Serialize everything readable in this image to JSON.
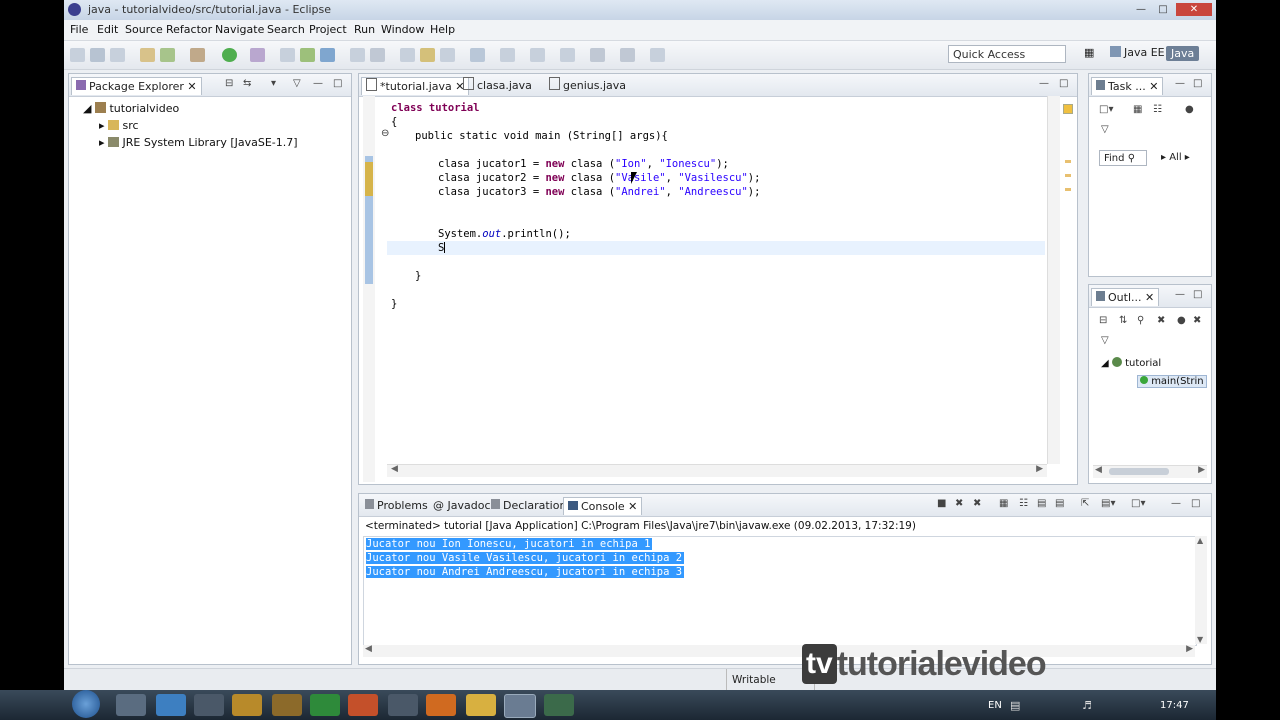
{
  "window": {
    "title": "java - tutorialvideo/src/tutorial.java - Eclipse"
  },
  "menu": [
    "File",
    "Edit",
    "Source",
    "Refactor",
    "Navigate",
    "Search",
    "Project",
    "Run",
    "Window",
    "Help"
  ],
  "quick_access": {
    "placeholder": "Quick Access"
  },
  "perspectives": {
    "java_ee": "Java EE",
    "java": "Java"
  },
  "package_explorer": {
    "tab": "Package Explorer",
    "items": [
      {
        "label": "tutorialvideo"
      },
      {
        "label": "src"
      },
      {
        "label": "JRE System Library [JavaSE-1.7]"
      }
    ]
  },
  "editor": {
    "tabs": [
      "*tutorial.java",
      "clasa.java",
      "genius.java"
    ],
    "lines": {
      "l1": "class tutorial",
      "l2": "{",
      "l3": "public static void main (String[] args){",
      "l4_type": "clasa jucator1 = ",
      "l4_new": "new",
      "l4_rest": " clasa (",
      "l4_s1": "\"Ion\"",
      "l4_c": ", ",
      "l4_s2": "\"Ionescu\"",
      "l4_end": ");",
      "l5_type": "clasa jucator2 = ",
      "l5_new": "new",
      "l5_rest": " clasa (",
      "l5_s1": "\"Vasile\"",
      "l5_c": ", ",
      "l5_s2": "\"Vasilescu\"",
      "l5_end": ");",
      "l6_type": "clasa jucator3 = ",
      "l6_new": "new",
      "l6_rest": " clasa (",
      "l6_s1": "\"Andrei\"",
      "l6_c": ", ",
      "l6_s2": "\"Andreescu\"",
      "l6_end": ");",
      "l7_a": "System.",
      "l7_b": "out",
      "l7_c": ".println();",
      "l8": "S",
      "l9": "}",
      "l10": "}"
    }
  },
  "task_list": {
    "tab": "Task ...",
    "find_placeholder": "Find",
    "all": "All"
  },
  "outline": {
    "tab": "Outl...",
    "root": "tutorial",
    "child": "main(Strin"
  },
  "bottom": {
    "tabs": [
      "Problems",
      "Javadoc",
      "Declaration",
      "Console"
    ],
    "terminated": "<terminated> tutorial [Java Application] C:\\Program Files\\Java\\jre7\\bin\\javaw.exe (09.02.2013, 17:32:19)",
    "output": [
      "Jucator nou Ion Ionescu, jucatori in echipa 1",
      "Jucator nou Vasile Vasilescu, jucatori in echipa 2",
      "Jucator nou Andrei Andreescu, jucatori in echipa 3"
    ]
  },
  "status": {
    "writable": "Writable"
  },
  "watermark": {
    "text": "tutorialevideo"
  },
  "tray": {
    "lang": "EN",
    "time": "17:47"
  },
  "colors": {
    "keyword": "#7f0055",
    "string": "#2a00ff",
    "selection": "#3399ff"
  }
}
